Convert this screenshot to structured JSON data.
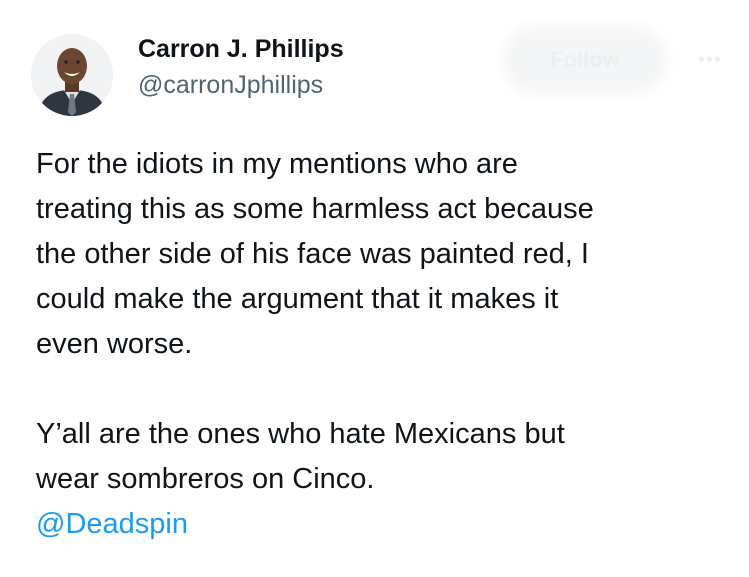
{
  "tweet": {
    "author": {
      "display_name": "Carron J. Phillips",
      "handle": "@carronJphillips"
    },
    "follow_label": "Follow",
    "more_icon": "more-horizontal-icon",
    "paragraphs": [
      "For the idiots in my mentions who are\ntreating this as some harmless act because\nthe other side of his face was painted red, I\ncould make the argument that it makes it\neven worse.",
      "Y’all are the ones who hate Mexicans but\nwear sombreros on Cinco."
    ],
    "mention": "@Deadspin"
  },
  "colors": {
    "text": "#0f1419",
    "secondary": "#536471",
    "link": "#1d9bf0"
  }
}
